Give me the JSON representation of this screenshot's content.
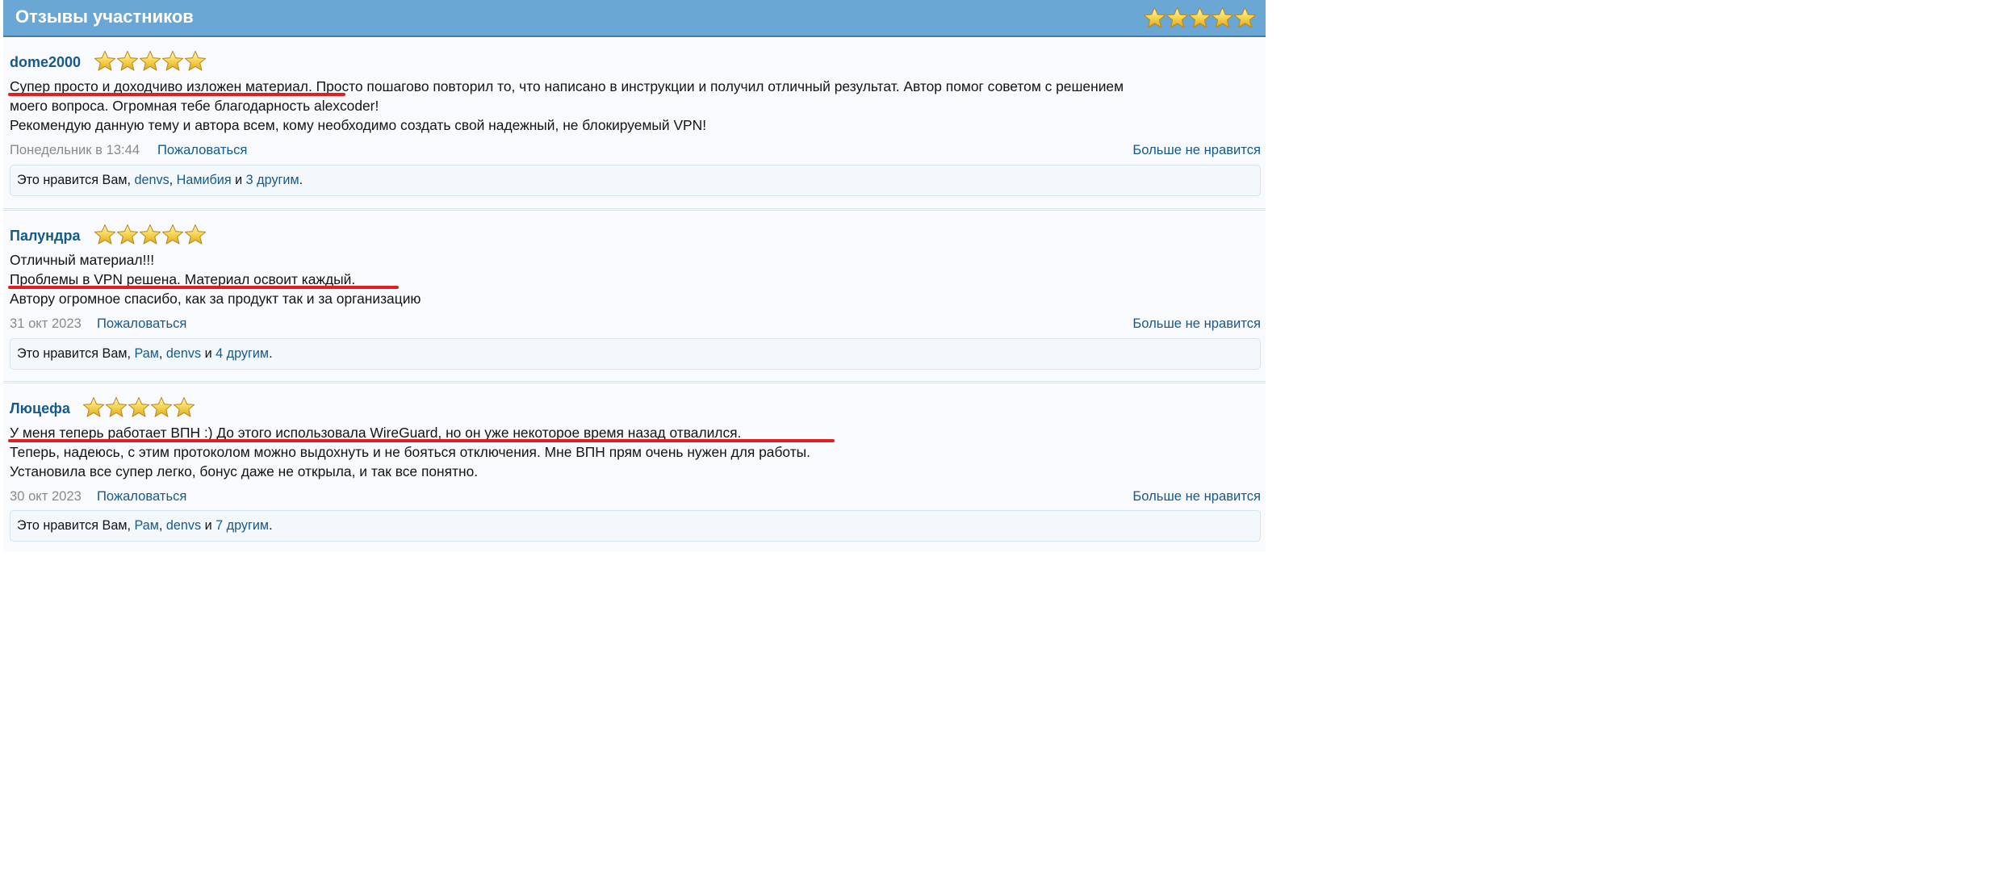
{
  "header": {
    "title": "Отзывы участников",
    "rating": 5
  },
  "posts": [
    {
      "author": "dome2000",
      "rating": 5,
      "lines": [
        "Супер просто и доходчиво изложен материал. Просто пошагово повторил то, что написано в инструкции и получил отличный результат. Автор помог советом с решением",
        "моего вопроса. Огромная тебе благодарность alexcoder!",
        "Рекомендую данную тему и автора всем, кому необходимо создать свой надежный, не блокируемый VPN!"
      ],
      "date": "Понедельник в 13:44",
      "report_label": "Пожаловаться",
      "unlike_label": "Больше не нравится",
      "likes": {
        "prefix": "Это нравится Вам,",
        "users": [
          "denvs",
          "Намибия"
        ],
        "and": "и",
        "others": "3 другим"
      }
    },
    {
      "author": "Палундра",
      "rating": 5,
      "lines": [
        "Отличный материал!!!",
        "Проблемы в VPN решена. Материал освоит каждый.",
        "Автору огромное спасибо, как за продукт так и за организацию"
      ],
      "date": "31 окт 2023",
      "report_label": "Пожаловаться",
      "unlike_label": "Больше не нравится",
      "likes": {
        "prefix": "Это нравится Вам,",
        "users": [
          "Рам",
          "denvs"
        ],
        "and": "и",
        "others": "4 другим"
      }
    },
    {
      "author": "Люцефа",
      "rating": 5,
      "lines": [
        "У меня теперь работает ВПН :) До этого использовала WireGuard, но он уже некоторое время назад отвалился.",
        "Теперь, надеюсь, с этим протоколом можно выдохнуть и не бояться отключения. Мне ВПН прям очень нужен для работы.",
        "Установила все супер легко, бонус даже не открыла, и так все понятно."
      ],
      "date": "30 окт 2023",
      "report_label": "Пожаловаться",
      "unlike_label": "Больше не нравится",
      "likes": {
        "prefix": "Это нравится Вам,",
        "users": [
          "Рам",
          "denvs"
        ],
        "and": "и",
        "others": "7 другим"
      }
    }
  ],
  "colors": {
    "header_bg": "#6aa7d4",
    "link": "#155a8a",
    "underline_mark": "#e02020",
    "star_fill": "#f5cf3f"
  },
  "icons": {
    "star": "star-icon"
  }
}
